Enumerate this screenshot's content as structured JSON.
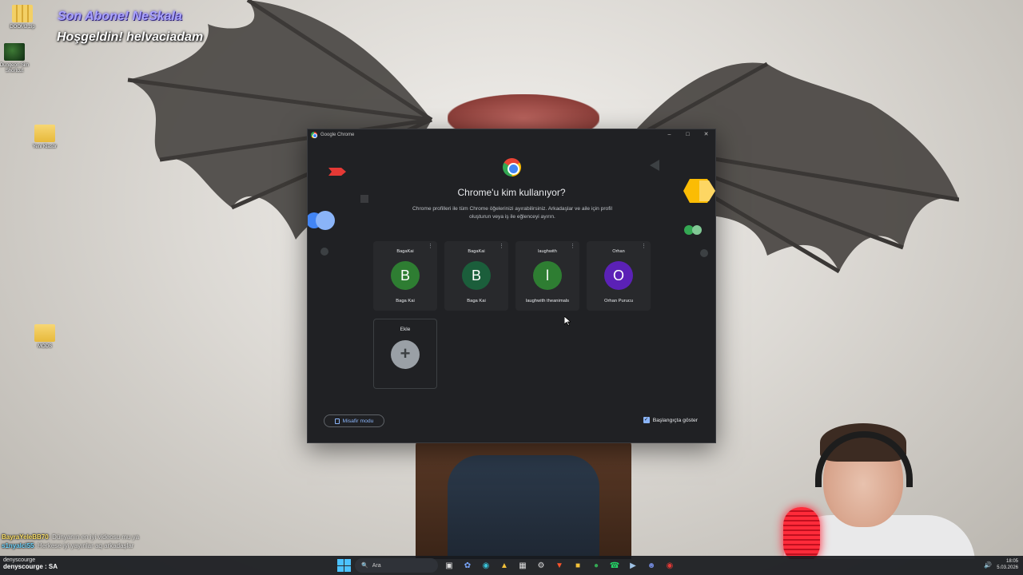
{
  "window": {
    "title": "Google Chrome",
    "minimize_icon": "minimize-icon",
    "maximize_icon": "maximize-icon",
    "close_icon": "close-icon"
  },
  "picker": {
    "heading": "Chrome'u kim kullanıyor?",
    "description": "Chrome profilleri ile tüm Chrome öğelerinizi ayırabilirsiniz. Arkadaşlar ve aile için profil oluşturun veya iş ile eğlenceyi ayırın.",
    "profiles": [
      {
        "account": "BagaKai",
        "initial": "B",
        "name": "Baga Kai",
        "color": "#2e7d32"
      },
      {
        "account": "BagaKai",
        "initial": "B",
        "name": "Baga Kai",
        "color": "#1b5e3b"
      },
      {
        "account": "laughwith",
        "initial": "l",
        "name": "laughwith theanimals",
        "color": "#2e7d32"
      },
      {
        "account": "Orhan",
        "initial": "O",
        "name": "Orhan Purucu",
        "color": "#5b21b6"
      }
    ],
    "add_label": "Ekle",
    "guest_label": "Misafir modu",
    "startup_label": "Başlangıçta göster",
    "startup_checked": true
  },
  "overlay": {
    "alert_title": "Son Abone! NeSkala",
    "alert_welcome": "Hoşgeldin! helvaciadam"
  },
  "desktop": {
    "icons": [
      {
        "label": "DOOM2.zip",
        "kind": "zip"
      },
      {
        "label": "Dungeon Sim Shortcut",
        "kind": "game"
      },
      {
        "label": "Yeni Klasör",
        "kind": "folder"
      },
      {
        "label": "MODS",
        "kind": "folder"
      }
    ]
  },
  "chat": {
    "lines": [
      {
        "user": "BayraYeleBB70",
        "text": ": Dünyanın en iyi videosu mu ya"
      },
      {
        "user": "s1nyalci55",
        "text": ": Herkese iyi yayınlar aq arkadaşlar"
      }
    ]
  },
  "taskbar": {
    "weather": "denyscourge",
    "chat_line": "denyscourge : SA",
    "search_placeholder": "Ara",
    "time": "18:05",
    "date": "5.03.2026"
  }
}
